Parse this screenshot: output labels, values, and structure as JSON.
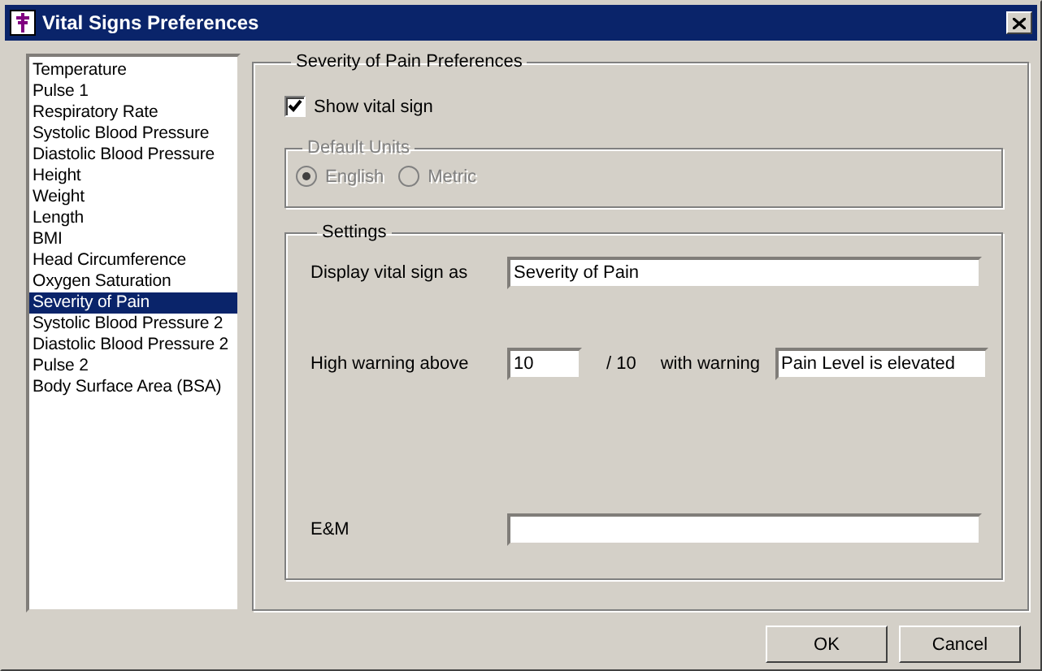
{
  "window": {
    "title": "Vital Signs Preferences"
  },
  "vital_signs": [
    {
      "label": "Temperature",
      "selected": false
    },
    {
      "label": "Pulse 1",
      "selected": false
    },
    {
      "label": "Respiratory Rate",
      "selected": false
    },
    {
      "label": "Systolic Blood Pressure",
      "selected": false
    },
    {
      "label": "Diastolic Blood Pressure",
      "selected": false
    },
    {
      "label": "Height",
      "selected": false
    },
    {
      "label": "Weight",
      "selected": false
    },
    {
      "label": "Length",
      "selected": false
    },
    {
      "label": "BMI",
      "selected": false
    },
    {
      "label": "Head Circumference",
      "selected": false
    },
    {
      "label": "Oxygen Saturation",
      "selected": false
    },
    {
      "label": "Severity of Pain",
      "selected": true
    },
    {
      "label": "Systolic Blood Pressure 2",
      "selected": false
    },
    {
      "label": "Diastolic Blood Pressure 2",
      "selected": false
    },
    {
      "label": "Pulse 2",
      "selected": false
    },
    {
      "label": "Body Surface Area (BSA)",
      "selected": false
    }
  ],
  "preferences": {
    "title": "Severity of Pain Preferences",
    "show_vital_sign": {
      "label": "Show vital sign",
      "checked": true
    },
    "default_units": {
      "title": "Default Units",
      "disabled": true,
      "options": [
        {
          "label": "English",
          "selected": true
        },
        {
          "label": "Metric",
          "selected": false
        }
      ]
    },
    "settings": {
      "title": "Settings",
      "display_as": {
        "label": "Display vital sign as",
        "value": "Severity of Pain"
      },
      "high_warning": {
        "label": "High warning above",
        "value": "10",
        "scale": "/ 10",
        "warning_label": "with warning",
        "warning_value": "Pain Level is elevated"
      },
      "em": {
        "label": "E&M"
      }
    }
  },
  "buttons": [
    "OK",
    "Cancel"
  ]
}
